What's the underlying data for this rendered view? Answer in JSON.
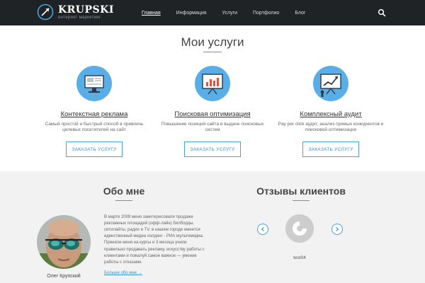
{
  "header": {
    "logo_title": "KRUPSKI",
    "logo_subtitle": "интернет маркетинг",
    "nav": [
      "Главная",
      "Информация",
      "Услуги",
      "Портфолио",
      "Блог"
    ],
    "active_nav": "Главная",
    "search_icon": "search-icon"
  },
  "services": {
    "title": "Мои услуги",
    "items": [
      {
        "icon": "monitor-icon",
        "title": "Контекстная реклама",
        "desc": "Самый простой и быстрый способ в привлечь целевых посетителей на сайт",
        "button": "ЗАКАЗАТЬ УСЛУГУ"
      },
      {
        "icon": "presentation-board-icon",
        "title": "Поисковая оптимизация",
        "desc": "Повышение позиций сайта в выдаче поисковых систем",
        "button": "ЗАКАЗАТЬ УСЛУГУ"
      },
      {
        "icon": "growth-chart-icon",
        "title": "Комплексный аудит",
        "desc": "Pay per click аудит, анализ прямых конкурентов и поисковой оптимизации",
        "button": "ЗАКАЗАТЬ УСЛУГУ"
      }
    ]
  },
  "about": {
    "title": "Обо мне",
    "text": "В марте 2009 меня заинтересовали продажи рекламных площадей (офф-лайн) билборды, ситилайты, радио и TV. в нашем городе имеется единственный медиа холдинг - РИА мультимедиа. Приняли меня на курсы и 3 месяца учили правильно продавать рекламу, искусству работы с клиентами и пожалуй самое важное — умение работы с отказами.",
    "link": "Больше обо мне →",
    "name": "Олег Крупский"
  },
  "reviews": {
    "title": "Отзывы клиентов",
    "client_name": "test04",
    "prev_icon": "chevron-left-icon",
    "next_icon": "chevron-right-icon"
  },
  "colors": {
    "accent": "#4aa0dc",
    "header_bg": "#1f2326",
    "icon_circle": "#5aaee8",
    "section_bg": "#f2f2f2"
  }
}
